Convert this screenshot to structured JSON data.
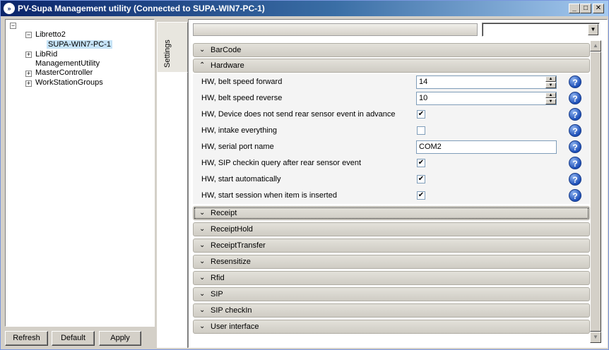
{
  "window": {
    "title": "PV-Supa Management utility (Connected to SUPA-WIN7-PC-1)",
    "icon": "app-icon",
    "controls": {
      "minimize": "_",
      "maximize": "□",
      "close": "✕"
    }
  },
  "tree": {
    "root_expander": "−",
    "nodes": [
      {
        "label": "Libretto2",
        "expander": "−"
      },
      {
        "label": "SUPA-WIN7-PC-1",
        "selected": true
      },
      {
        "label": "LibRid",
        "expander": "+"
      },
      {
        "label": "ManagementUtility"
      },
      {
        "label": "MasterController",
        "expander": "+"
      },
      {
        "label": "WorkStationGroups",
        "expander": "+"
      }
    ]
  },
  "buttons": {
    "refresh": "Refresh",
    "default": "Default",
    "apply": "Apply"
  },
  "tabs": {
    "settings": "Settings"
  },
  "top": {
    "combo_value": ""
  },
  "sections": {
    "barcode": "BarCode",
    "hardware": "Hardware",
    "receipt": "Receipt",
    "receipt_hold": "ReceiptHold",
    "receipt_transfer": "ReceiptTransfer",
    "resensitize": "Resensitize",
    "rfid": "Rfid",
    "sip": "SIP",
    "sip_checkin": "SIP checkIn",
    "user_interface": "User interface"
  },
  "hardware": {
    "rows": [
      {
        "label": "HW, belt speed forward",
        "type": "spin",
        "value": "14"
      },
      {
        "label": "HW, belt speed reverse",
        "type": "spin",
        "value": "10"
      },
      {
        "label": "HW, Device does not send rear sensor event in advance",
        "type": "checkbox",
        "checked": true
      },
      {
        "label": "HW, intake everything",
        "type": "checkbox",
        "checked": false
      },
      {
        "label": "HW, serial port name",
        "type": "text",
        "value": "COM2"
      },
      {
        "label": "HW, SIP checkin query after rear sensor event",
        "type": "checkbox",
        "checked": true
      },
      {
        "label": "HW, start automatically",
        "type": "checkbox",
        "checked": true
      },
      {
        "label": "HW, start session when item is inserted",
        "type": "checkbox",
        "checked": true
      }
    ]
  },
  "glyphs": {
    "check": "✔",
    "help": "?",
    "chevron_up": "⌃",
    "chevron_down": "⌄",
    "spin_up": "▲",
    "spin_down": "▼",
    "arrow_down": "▼",
    "arrow_up": "▲"
  }
}
